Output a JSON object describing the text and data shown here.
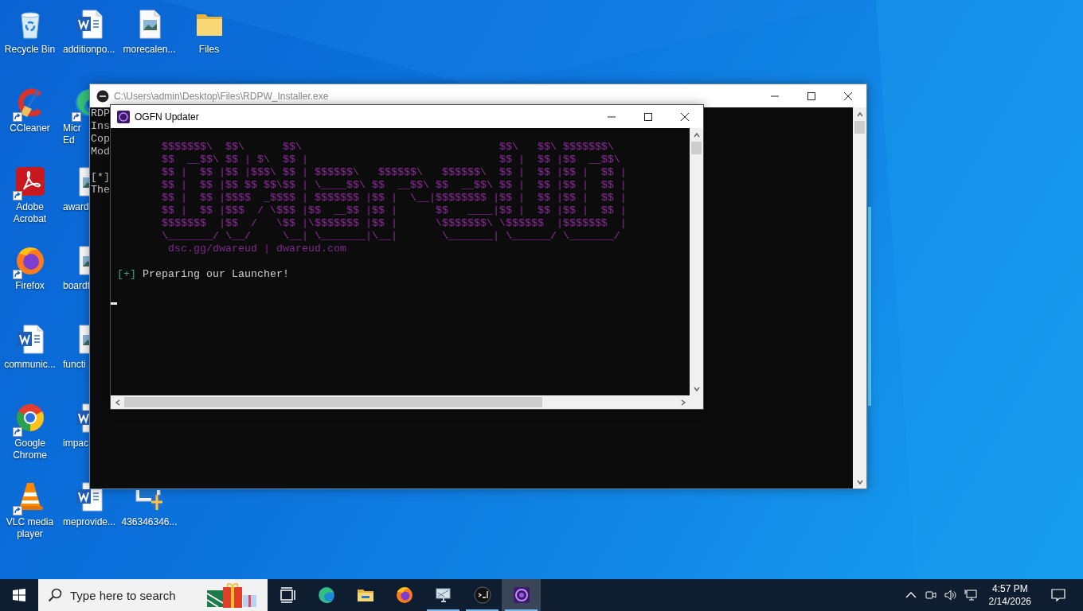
{
  "desktop_icons": [
    [
      {
        "kind": "recycle-bin",
        "label_lines": [
          "Recycle Bin"
        ],
        "shortcut": false
      },
      {
        "kind": "ccleaner",
        "label_lines": [
          "CCleaner"
        ],
        "shortcut": true
      },
      {
        "kind": "acrobat",
        "label_lines": [
          "Adobe",
          "Acrobat"
        ],
        "shortcut": true
      },
      {
        "kind": "firefox",
        "label_lines": [
          "Firefox"
        ],
        "shortcut": true
      },
      {
        "kind": "word",
        "label_lines": [
          "communic..."
        ],
        "shortcut": false
      },
      {
        "kind": "chrome",
        "label_lines": [
          "Google",
          "Chrome"
        ],
        "shortcut": true
      },
      {
        "kind": "vlc",
        "label_lines": [
          "VLC media",
          "player"
        ],
        "shortcut": true
      }
    ],
    [
      {
        "kind": "word",
        "label_lines": [
          "additionpo..."
        ],
        "shortcut": false
      },
      {
        "kind": "edge",
        "label_lines": [
          "Micr",
          "Ed"
        ],
        "shortcut": true,
        "clip_right": true
      },
      {
        "kind": "image",
        "label_lines": [
          "award"
        ],
        "shortcut": false,
        "clip_right": true
      },
      {
        "kind": "image",
        "label_lines": [
          "boardt"
        ],
        "shortcut": false,
        "clip_right": true
      },
      {
        "kind": "image",
        "label_lines": [
          "functi"
        ],
        "shortcut": false,
        "clip_right": true
      },
      {
        "kind": "word",
        "label_lines": [
          "impac"
        ],
        "shortcut": false,
        "clip_right": true
      },
      {
        "kind": "word",
        "label_lines": [
          "meprovide..."
        ],
        "shortcut": false
      }
    ],
    [
      {
        "kind": "image",
        "label_lines": [
          "morecalen..."
        ],
        "shortcut": false
      },
      {
        "kind": "installer",
        "label_lines": [
          "436346346..."
        ],
        "shortcut": false,
        "clip_top": true
      }
    ],
    [
      {
        "kind": "folder",
        "label_lines": [
          "Files"
        ],
        "shortcut": false
      }
    ]
  ],
  "back_window": {
    "title": "C:\\Users\\admin\\Desktop\\Files\\RDPW_Installer.exe",
    "paragraphs": [
      [
        "RDP",
        "Ins",
        "Cop",
        "Mod"
      ],
      [
        "[*]",
        "The"
      ]
    ]
  },
  "front_window": {
    "title": "OGFN Updater",
    "banner": [
      "$$$$$$$\\  $$\\      $$\\                               $$\\   $$\\ $$$$$$$\\",
      "$$  __$$\\ $$ | $\\  $$ |                              $$ |  $$ |$$  __$$\\",
      "$$ |  $$ |$$ |$$$\\ $$ | $$$$$$\\   $$$$$$\\   $$$$$$\\  $$ |  $$ |$$ |  $$ |",
      "$$ |  $$ |$$ $$ $$\\$$ | \\____$$\\ $$  __$$\\ $$  __$$\\ $$ |  $$ |$$ |  $$ |",
      "$$ |  $$ |$$$$  _$$$$ | $$$$$$$ |$$ |  \\__|$$$$$$$$ |$$ |  $$ |$$ |  $$ |",
      "$$ |  $$ |$$$  / \\$$$ |$$  __$$ |$$ |      $$   ____|$$ |  $$ |$$ |  $$ |",
      "$$$$$$$  |$$  /   \\$$ |\\$$$$$$$ |$$ |      \\$$$$$$$\\ \\$$$$$$  |$$$$$$$  |",
      "\\_______/ \\__/     \\__| \\_______|\\__|       \\_______| \\______/ \\_______/"
    ],
    "links": "dsc.gg/dwareud | dwareud.com",
    "status": {
      "prefix": "[+]",
      "text": "Preparing our Launcher!"
    }
  },
  "taskbar": {
    "search_placeholder": "Type here to search",
    "apps": [
      {
        "kind": "task-view",
        "running": false,
        "selected": false
      },
      {
        "kind": "edge",
        "running": false,
        "selected": false
      },
      {
        "kind": "explorer",
        "running": false,
        "selected": false
      },
      {
        "kind": "firefox",
        "running": false,
        "selected": false
      },
      {
        "kind": "display",
        "running": true,
        "selected": false
      },
      {
        "kind": "console",
        "running": true,
        "selected": false
      },
      {
        "kind": "ogfn",
        "running": true,
        "selected": true
      }
    ],
    "clock": {
      "time": "4:57 PM",
      "date": "2/14/2026"
    }
  }
}
